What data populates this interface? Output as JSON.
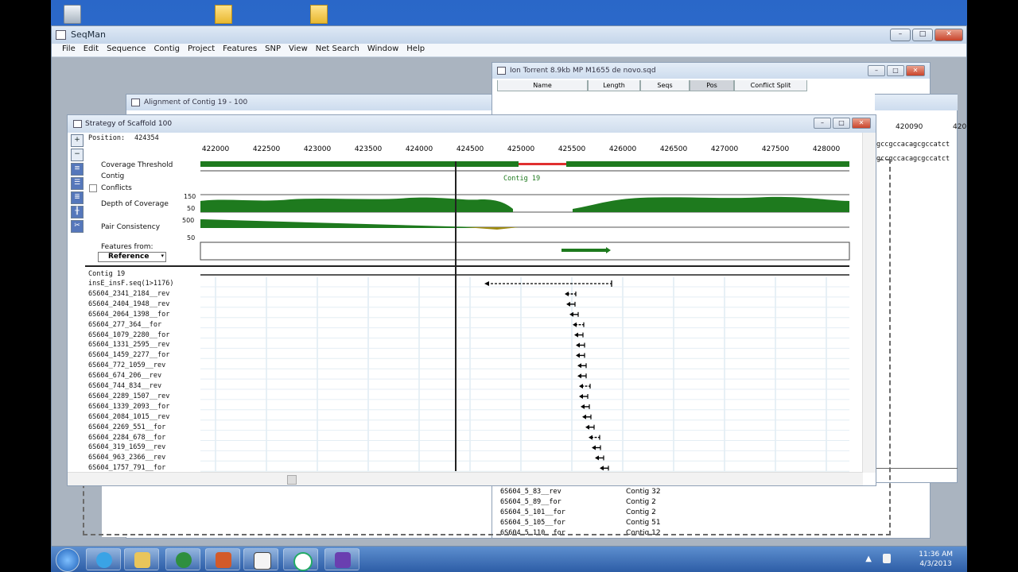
{
  "main_window": {
    "title": "SeqMan",
    "menu": [
      "File",
      "Edit",
      "Sequence",
      "Contig",
      "Project",
      "Features",
      "SNP",
      "View",
      "Net Search",
      "Window",
      "Help"
    ]
  },
  "ion_window": {
    "title": "Ion Torrent 8.9kb MP M1655 de novo.sqd",
    "columns": [
      "Name",
      "Length",
      "Seqs",
      "Pos",
      "Conflict Split"
    ],
    "right_axis": [
      "420090",
      "420"
    ],
    "right_seq": [
      "gccgccacagcgccatct",
      "gccgccacagcgccatct"
    ],
    "rows": [
      {
        "name": "6S604_5_83__rev",
        "contig": "Contig 32"
      },
      {
        "name": "6S604_5_89__for",
        "contig": "Contig 2"
      },
      {
        "name": "6S604_5_101__for",
        "contig": "Contig 2"
      },
      {
        "name": "6S604_5_105__for",
        "contig": "Contig 51"
      },
      {
        "name": "6S604_5_110__for",
        "contig": "Contig 12"
      }
    ]
  },
  "alignment_window": {
    "title": "Alignment of Contig 19 - 100"
  },
  "strategy_window": {
    "title": "Strategy of Scaffold 100",
    "position_label": "Position:",
    "position_value": "424354",
    "ruler": [
      "422000",
      "422500",
      "423000",
      "423500",
      "424000",
      "424500",
      "425000",
      "425500",
      "426000",
      "426500",
      "427000",
      "427500",
      "428000"
    ],
    "track_labels": {
      "coverage_threshold": "Coverage Threshold",
      "contig": "Contig",
      "conflicts": "Conflicts",
      "depth": "Depth of Coverage",
      "pair": "Pair Consistency",
      "features_from": "Features from:",
      "reference": "Reference"
    },
    "depth_ticks": [
      "150",
      "50"
    ],
    "pair_ticks": [
      "500",
      "50"
    ],
    "contig_label": "Contig 19",
    "reads_header": "Contig 19",
    "reads": [
      "insE_insF.seq(1>1176)",
      "6S604_2341_2184__rev",
      "6S604_2404_1948__rev",
      "6S604_2064_1398__for",
      "6S604_277_364__for",
      "6S604_1079_2280__for",
      "6S604_1331_2595__rev",
      "6S604_1459_2277__for",
      "6S604_772_1059__rev",
      "6S604_674_206__rev",
      "6S604_744_834__rev",
      "6S604_2289_1507__rev",
      "6S604_1339_2093__for",
      "6S604_2084_1015__rev",
      "6S604_2269_551__for",
      "6S604_2284_678__for",
      "6S604_319_1659__rev",
      "6S604_963_2366__rev",
      "6S604_1757_791__for"
    ]
  },
  "taskbar": {
    "time": "11:36 AM",
    "date": "4/3/2013"
  },
  "colors": {
    "coverage_green": "#1e7a1e",
    "conflict_red": "#e03030",
    "window_blue": "#2a67c8"
  }
}
